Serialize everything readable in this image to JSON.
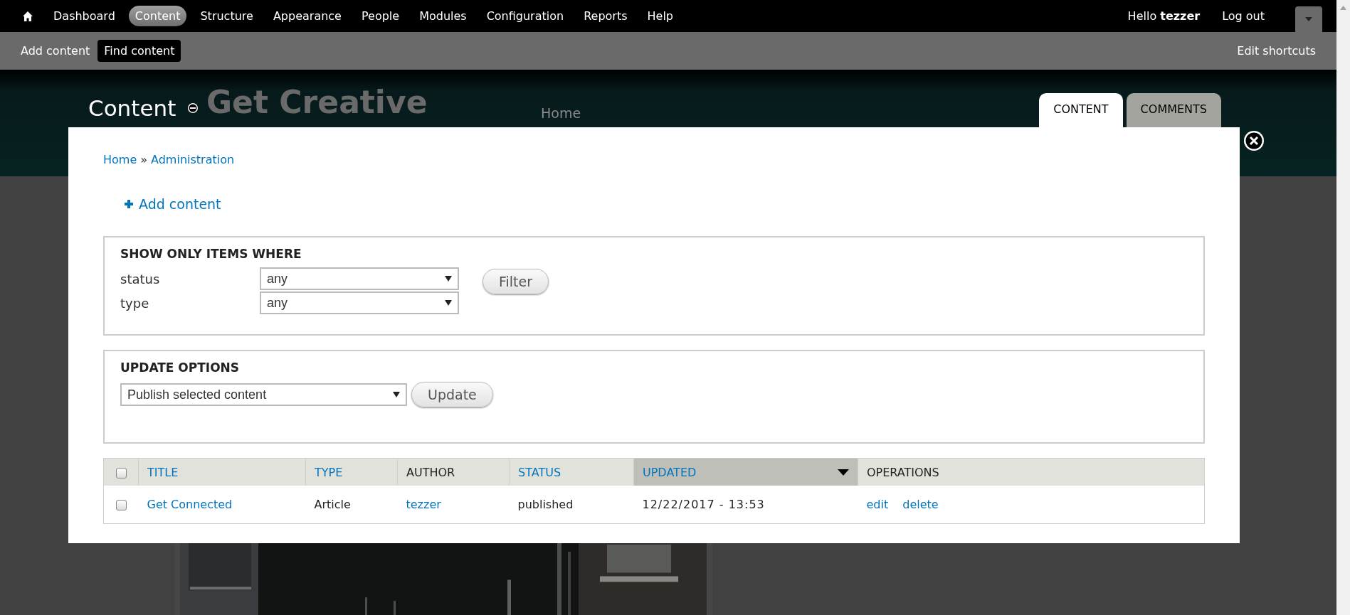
{
  "toolbar": {
    "menu": [
      {
        "label": "Dashboard",
        "selected": false
      },
      {
        "label": "Content",
        "selected": true
      },
      {
        "label": "Structure",
        "selected": false
      },
      {
        "label": "Appearance",
        "selected": false
      },
      {
        "label": "People",
        "selected": false
      },
      {
        "label": "Modules",
        "selected": false
      },
      {
        "label": "Configuration",
        "selected": false
      },
      {
        "label": "Reports",
        "selected": false
      },
      {
        "label": "Help",
        "selected": false
      }
    ],
    "greeting": "Hello **tezzer**",
    "logout": "Log out"
  },
  "shortcuts": {
    "items": [
      {
        "label": "Add content",
        "selected": false
      },
      {
        "label": "Find content",
        "selected": true
      }
    ],
    "edit": "Edit shortcuts"
  },
  "header": {
    "title": "Content",
    "tabs": [
      {
        "label": "CONTENT",
        "selected": true
      },
      {
        "label": "COMMENTS",
        "selected": false
      }
    ]
  },
  "background_site": {
    "site_name": "Get Creative",
    "nav_link": "Home"
  },
  "dialog": {
    "breadcrumb": [
      "Home",
      "Administration"
    ],
    "separator": "»",
    "action": "Add content",
    "filter": {
      "legend": "SHOW ONLY ITEMS WHERE",
      "fields": [
        {
          "label": "status",
          "value": "any"
        },
        {
          "label": "type",
          "value": "any"
        }
      ],
      "button": "Filter"
    },
    "update": {
      "legend": "UPDATE OPTIONS",
      "value": "Publish selected content",
      "button": "Update"
    },
    "table": {
      "select_all_checked": false,
      "columns": [
        {
          "label": "TITLE",
          "kind": "link",
          "selected": false
        },
        {
          "label": "TYPE",
          "kind": "link",
          "selected": false
        },
        {
          "label": "AUTHOR",
          "kind": "plain",
          "selected": false
        },
        {
          "label": "STATUS",
          "kind": "link",
          "selected": false
        },
        {
          "label": "UPDATED",
          "kind": "link",
          "selected": true
        },
        {
          "label": "OPERATIONS",
          "kind": "plain",
          "selected": false
        }
      ],
      "rows": [
        {
          "checked": false,
          "title": "Get Connected",
          "type": "Article",
          "author": "tezzer",
          "status": "published",
          "updated": "12/22/2017 - 13:53",
          "operations": [
            "edit",
            "delete"
          ]
        }
      ]
    }
  }
}
